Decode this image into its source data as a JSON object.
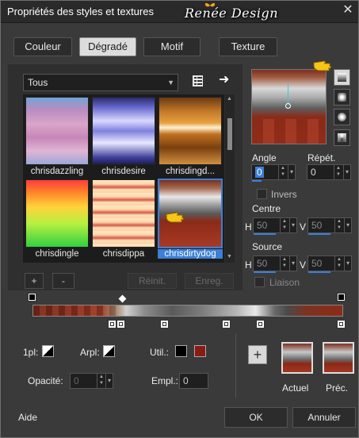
{
  "window": {
    "title": "Propriétés des styles et textures",
    "watermark": "Renée Design",
    "close_glyph": "✕"
  },
  "tabs": [
    {
      "label": "Couleur",
      "active": false
    },
    {
      "label": "Dégradé",
      "active": true
    },
    {
      "label": "Motif",
      "active": false
    },
    {
      "label": "Texture",
      "active": false
    }
  ],
  "category": {
    "value": "Tous"
  },
  "gallery": {
    "items": [
      {
        "label": "chrisdazzling"
      },
      {
        "label": "chrisdesire"
      },
      {
        "label": "chrisdingd..."
      },
      {
        "label": "chrisdingle"
      },
      {
        "label": "chrisdippa"
      },
      {
        "label": "chrisdirtydog",
        "selected": true
      }
    ]
  },
  "list_buttons": {
    "add": "+",
    "remove": "-",
    "reset": "Réinit.",
    "save": "Enreg."
  },
  "right": {
    "angle_label": "Angle",
    "angle_value": "0",
    "repeat_label": "Répét.",
    "repeat_value": "0",
    "invert_label": "Invers",
    "center_label": "Centre",
    "center_h_label": "H",
    "center_h": "50",
    "center_v_label": "V",
    "center_v": "50",
    "source_label": "Source",
    "source_h_label": "H",
    "source_h": "50",
    "source_v_label": "V",
    "source_v": "50",
    "link_label": "Liaison"
  },
  "stop": {
    "px_label": "1pl:",
    "arpl_label": "Arpl:",
    "util_label": "Util.:",
    "opacity_label": "Opacité:",
    "opacity_value": "0",
    "empl_label": "Empl.:",
    "empl_value": "0",
    "util_color_a": "#000000",
    "util_color_b": "#8b1a12"
  },
  "previews": {
    "add": "+",
    "current_label": "Actuel",
    "previous_label": "Préc."
  },
  "footer": {
    "help": "Aide",
    "ok": "OK",
    "cancel": "Annuler"
  },
  "colors": {
    "accent": "#3b7fd6",
    "bg": "#3a3a3a",
    "rust": "#8b2a18"
  }
}
